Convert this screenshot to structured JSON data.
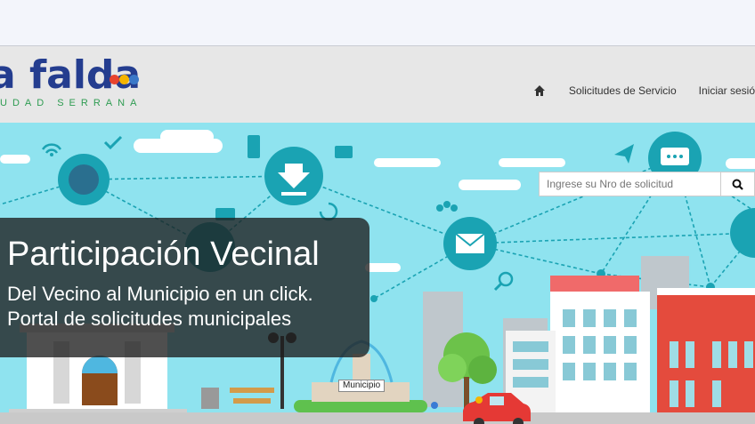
{
  "header": {
    "logo_text": "a falda",
    "logo_tagline": "UDAD  SERRANA"
  },
  "nav": {
    "home_icon": "home-icon",
    "items": [
      {
        "label": "Solicitudes de Servicio"
      },
      {
        "label": "Iniciar sesió"
      }
    ]
  },
  "hero": {
    "title": "Participación Vecinal",
    "subtitle1": "Del Vecino al Municipio en un click.",
    "subtitle2": "Portal de solicitudes municipales",
    "tooltip": "Municipio"
  },
  "search": {
    "placeholder": "Ingrese su Nro de solicitud",
    "button_icon": "search-icon"
  },
  "colors": {
    "brand_blue": "#243d8f",
    "brand_green": "#2f9c52",
    "hero_bg": "#8fe3ef",
    "node_teal": "#1aa3b3"
  }
}
